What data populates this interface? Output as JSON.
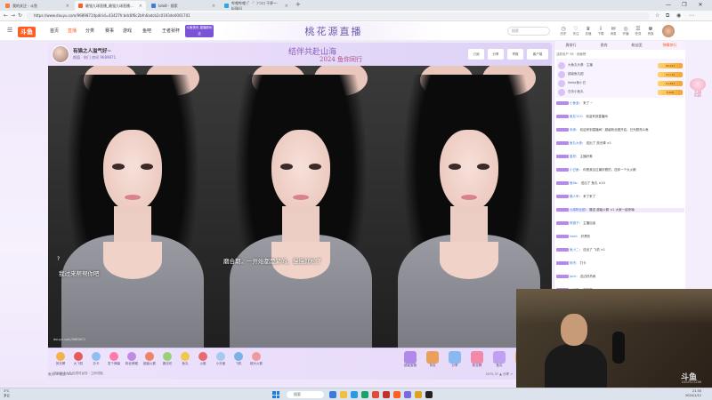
{
  "browser": {
    "tabs": [
      {
        "label": "我的关注 - 斗鱼",
        "icon_color": "#ff7a3a"
      },
      {
        "label": "最强九球直播_最强九球直播...",
        "icon_color": "#ff5d23",
        "active": true
      },
      {
        "label": "lolo8 - 搜索",
        "icon_color": "#3d7bd9"
      },
      {
        "label": "哔哩哔哩 (゜-゜)つロ 干杯~-bilibili",
        "icon_color": "#2aa6e0"
      }
    ],
    "new_tab": "+",
    "window_controls": [
      "—",
      "❐",
      "✕"
    ],
    "url": "https://www.douyu.com/9689871ltpdirid=43427fr.bdc8f6c2bfn6adcb2c0193de0001701"
  },
  "site": {
    "logo": "斗鱼",
    "nav": [
      {
        "label": "首页",
        "active": false
      },
      {
        "label": "直播",
        "active": true
      },
      {
        "label": "分类",
        "active": false
      },
      {
        "label": "赛事",
        "active": false
      },
      {
        "label": "游戏",
        "active": false
      },
      {
        "label": "鱼吧",
        "active": false
      },
      {
        "label": "王者祯杯",
        "active": false
      }
    ],
    "nav_badge": "斗鱼快讯 直播新玩法",
    "banner": "桃花源直播",
    "search_placeholder": "搜索",
    "header_icons": [
      {
        "glyph": "◷",
        "label": "历史"
      },
      {
        "glyph": "♡",
        "label": "关注"
      },
      {
        "glyph": "♛",
        "label": "充值"
      },
      {
        "glyph": "⇩",
        "label": "下载"
      },
      {
        "glyph": "✉",
        "label": "消息"
      },
      {
        "glyph": "◎",
        "label": "开播"
      },
      {
        "glyph": "☰",
        "label": "任务"
      },
      {
        "glyph": "♚",
        "label": "贵族"
      }
    ]
  },
  "room": {
    "title": "有猫之人溢气好~",
    "subtitle": "颜值 · 热门",
    "room_id": "房间 9689871",
    "center_line1": "结伴共赴山海",
    "center_line2": "2024 鱼你同行",
    "header_buttons": [
      "订阅",
      "分享",
      "举报",
      "客户端"
    ],
    "panel_subtitles": [
      "我过来帮帮你吧",
      "磨合期，一开始都是紧的，慢慢就松了"
    ],
    "question_mark": "?",
    "watermark": "douyu.com/9689871"
  },
  "gifts": {
    "left": [
      {
        "label": "荧光棒",
        "color": "#f5b14a"
      },
      {
        "label": "大飞机",
        "color": "#e85a5a"
      },
      {
        "label": "办卡",
        "color": "#8cc0f0"
      },
      {
        "label": "发个弹幕",
        "color": "#ff7aa8"
      },
      {
        "label": "粉丝荣耀",
        "color": "#c08ae8"
      },
      {
        "label": "超级火箭",
        "color": "#f0826a"
      },
      {
        "label": "魔法坨",
        "color": "#9ad07a"
      },
      {
        "label": "鱼丸",
        "color": "#f0c84a"
      },
      {
        "label": "火箭",
        "color": "#e86a6a"
      },
      {
        "label": "小天使",
        "color": "#a8c8f0"
      },
      {
        "label": "飞机",
        "color": "#7ab0e8"
      },
      {
        "label": "超大火箭",
        "color": "#f09aa0"
      }
    ],
    "right": [
      {
        "label": "超级宝箱",
        "color": "#b08ae8"
      },
      {
        "label": "背包",
        "color": "#e8a05a"
      },
      {
        "label": "分享",
        "color": "#8ab8f0"
      },
      {
        "label": "粉丝牌",
        "color": "#f08aa8"
      },
      {
        "label": "鱼丸",
        "color": "#c0a0f0"
      },
      {
        "label": "贵族",
        "color": "#f0b04a"
      }
    ],
    "row2": "超级开卡大礼包限时返场 · 立即领取"
  },
  "status": {
    "left": "鱼丸: 0    鱼翅: 0.0",
    "right": "2575,37 ▲    分享 ↗"
  },
  "chat": {
    "tabs": [
      {
        "label": "周排行",
        "active": false
      },
      {
        "label": "贵宾",
        "active": false
      },
      {
        "label": "粉丝团",
        "active": false
      },
      {
        "label": "弹幕排行",
        "active": true
      }
    ],
    "summary": "活跃用户 38 · 贡献榜",
    "rank": [
      {
        "name": "大鱼丸头像 · 主播",
        "value": "48,292"
      },
      {
        "name": "超级鱼丸团",
        "value": "23,110"
      },
      {
        "name": "Ikeba鱼小白",
        "value": "12,804"
      },
      {
        "name": "白衣小鱼丸",
        "value": "8,406"
      }
    ],
    "messages": [
      {
        "name": "小鱼宝",
        "text": "来了 ~"
      },
      {
        "name": "鱼友123",
        "text": "欢迎来到直播间"
      },
      {
        "name": "系统",
        "text": "欢迎来到直播间！超级粉丝团开启，日光照亮斗鱼"
      },
      {
        "name": "鱼丸大侠",
        "text": "送出了 荧光棒 ×1"
      },
      {
        "name": "星辰",
        "text": "主播好美"
      },
      {
        "name": "小白鱼",
        "text": "你是我见过最好看的，送你一个大火箭"
      },
      {
        "name": "鱼Bb",
        "text": "送出了 鱼丸 ×10"
      },
      {
        "name": "路人甲",
        "text": "来了来了"
      },
      {
        "name": "九球粉丝团",
        "text": "赠送 超级火箭 ×1 大家一起来嗨"
      },
      {
        "name": "夜猫子",
        "text": "主播加油"
      },
      {
        "name": "liwei",
        "text": "好漂亮"
      },
      {
        "name": "鱼小二",
        "text": "送出了 飞机 ×1"
      },
      {
        "name": "阿杰",
        "text": "打卡"
      },
      {
        "name": "Jack",
        "text": "这边好热闹"
      },
      {
        "name": "小可爱",
        "text": "你好呀"
      },
      {
        "name": "夏天",
        "text": "来点歌"
      },
      {
        "name": "鱼多多",
        "text": "支持一下"
      },
      {
        "name": "路过",
        "text": "关注了"
      },
      {
        "name": "大鱼丸",
        "text": "赠送 荧光棒 ×50"
      },
      {
        "name": "乐乐",
        "text": "哈哈哈"
      }
    ],
    "input_placeholder": "这里输入聊天内容"
  },
  "mascot": "九球\n938",
  "webcam": {
    "logo": "斗鱼",
    "sub": "DOUYU.COM"
  },
  "taskbar": {
    "weather_temp": "3°C",
    "weather_desc": "多云",
    "search": "搜索",
    "clock_time": "21:30",
    "clock_date": "2024/1/12"
  }
}
